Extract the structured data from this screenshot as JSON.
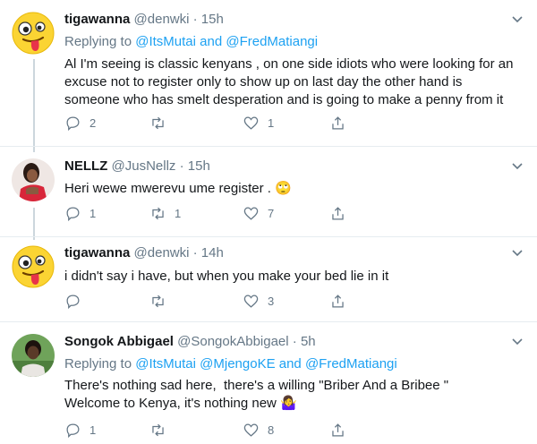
{
  "tweets": [
    {
      "name": "tigawanna",
      "handle": "@denwki",
      "separator": "·",
      "time": "15h",
      "reply_prefix": "Replying to",
      "reply_targets": [
        "@ItsMutai",
        "and",
        "@FredMatiangi"
      ],
      "text": "Al I'm seeing is classic kenyans , on one side idiots who were looking for an excuse not to register only to show up on last day the other hand is someone who has smelt desperation and is going to make a penny from it",
      "replies": "2",
      "retweets": "",
      "likes": "1",
      "avatar_icon": "silly-face-emoji"
    },
    {
      "name": "NELLZ",
      "handle": "@JusNellz",
      "separator": "·",
      "time": "15h",
      "text": "Heri wewe mwerevu ume register .",
      "emoji": "🙄",
      "replies": "1",
      "retweets": "1",
      "likes": "7",
      "avatar_icon": "profile-photo"
    },
    {
      "name": "tigawanna",
      "handle": "@denwki",
      "separator": "·",
      "time": "14h",
      "text": "i didn't say i have, but when you make your bed lie in it",
      "replies": "",
      "retweets": "",
      "likes": "3",
      "avatar_icon": "silly-face-emoji"
    },
    {
      "name": "Songok Abbigael",
      "handle": "@SongokAbbigael",
      "separator": "·",
      "time": "5h",
      "reply_prefix": "Replying to",
      "reply_targets": [
        "@ItsMutai",
        "@MjengoKE",
        "and",
        "@FredMatiangi"
      ],
      "text_line1": "There's nothing sad here,  there's a willing \"Briber And a Bribee \"",
      "text_line2": "Welcome to Kenya, it's nothing new",
      "emoji": "🤷‍♀️",
      "replies": "1",
      "retweets": "",
      "likes": "8",
      "avatar_icon": "profile-photo"
    }
  ],
  "colors": {
    "link": "#1da1f2",
    "meta": "#657786",
    "text": "#14171a",
    "divider": "#e6ecf0",
    "thread_line": "#ccd6dd"
  }
}
